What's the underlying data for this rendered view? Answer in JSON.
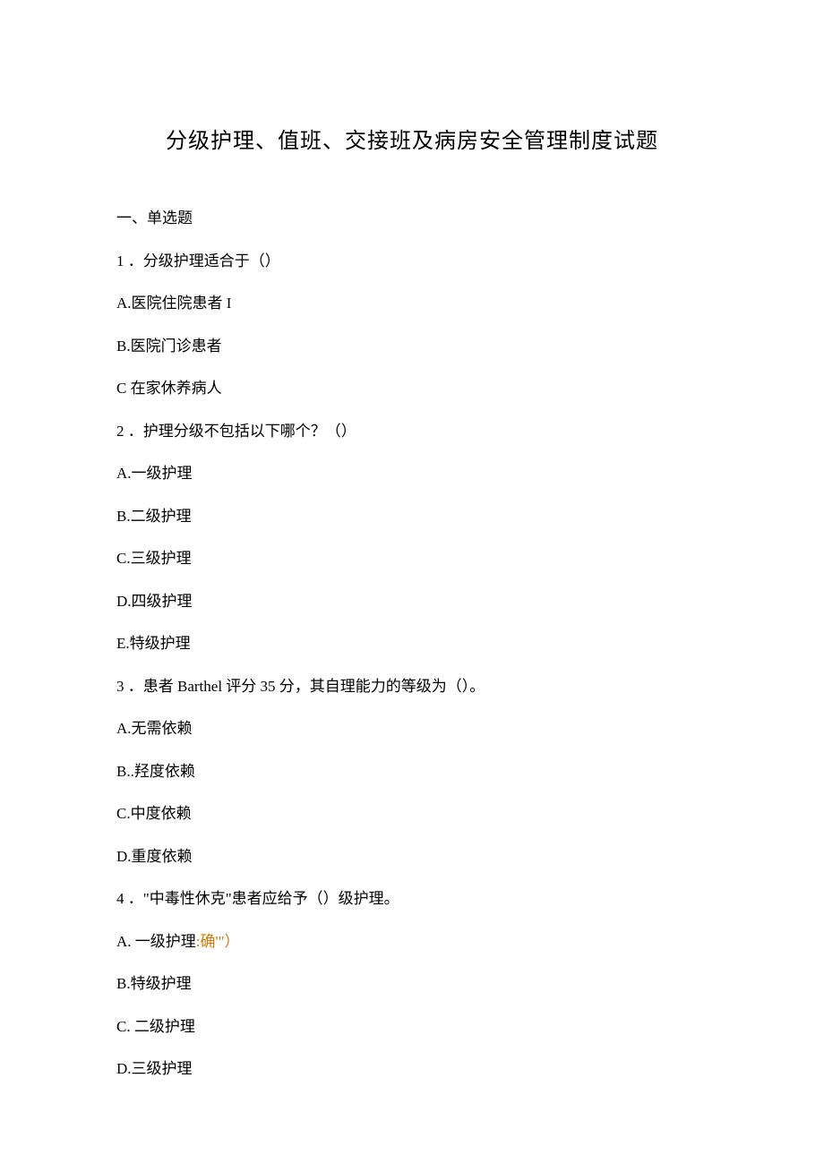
{
  "title": "分级护理、值班、交接班及病房安全管理制度试题",
  "section": "一、单选题",
  "questions": [
    {
      "num": "1 ．",
      "text": "分级护理适合于（）",
      "options": [
        "A.医院住院患者 I",
        "B.医院门诊患者",
        "C 在家休养病人"
      ]
    },
    {
      "num": "2  ．",
      "text": "护理分级不包括以下哪个？（）",
      "options": [
        "A.一级护理",
        "B.二级护理",
        "C.三级护理",
        "D.四级护理",
        "E.特级护理"
      ]
    },
    {
      "num": "3  ．",
      "text": "患者 Barthel 评分 35 分，其自理能力的等级为（）。",
      "options": [
        "A.无需依赖",
        "B..羟度依赖",
        "C.中度依赖",
        "D.重度依赖"
      ]
    },
    {
      "num": "4  ．",
      "text": "\"中毒性休克\"患者应给予（）级护理。",
      "options": [
        "A. 一级护理",
        "B.特级护理",
        "C. 二级护理",
        "D.三级护理"
      ],
      "hint_index": 0,
      "hint_text": ":确'\"）"
    }
  ]
}
